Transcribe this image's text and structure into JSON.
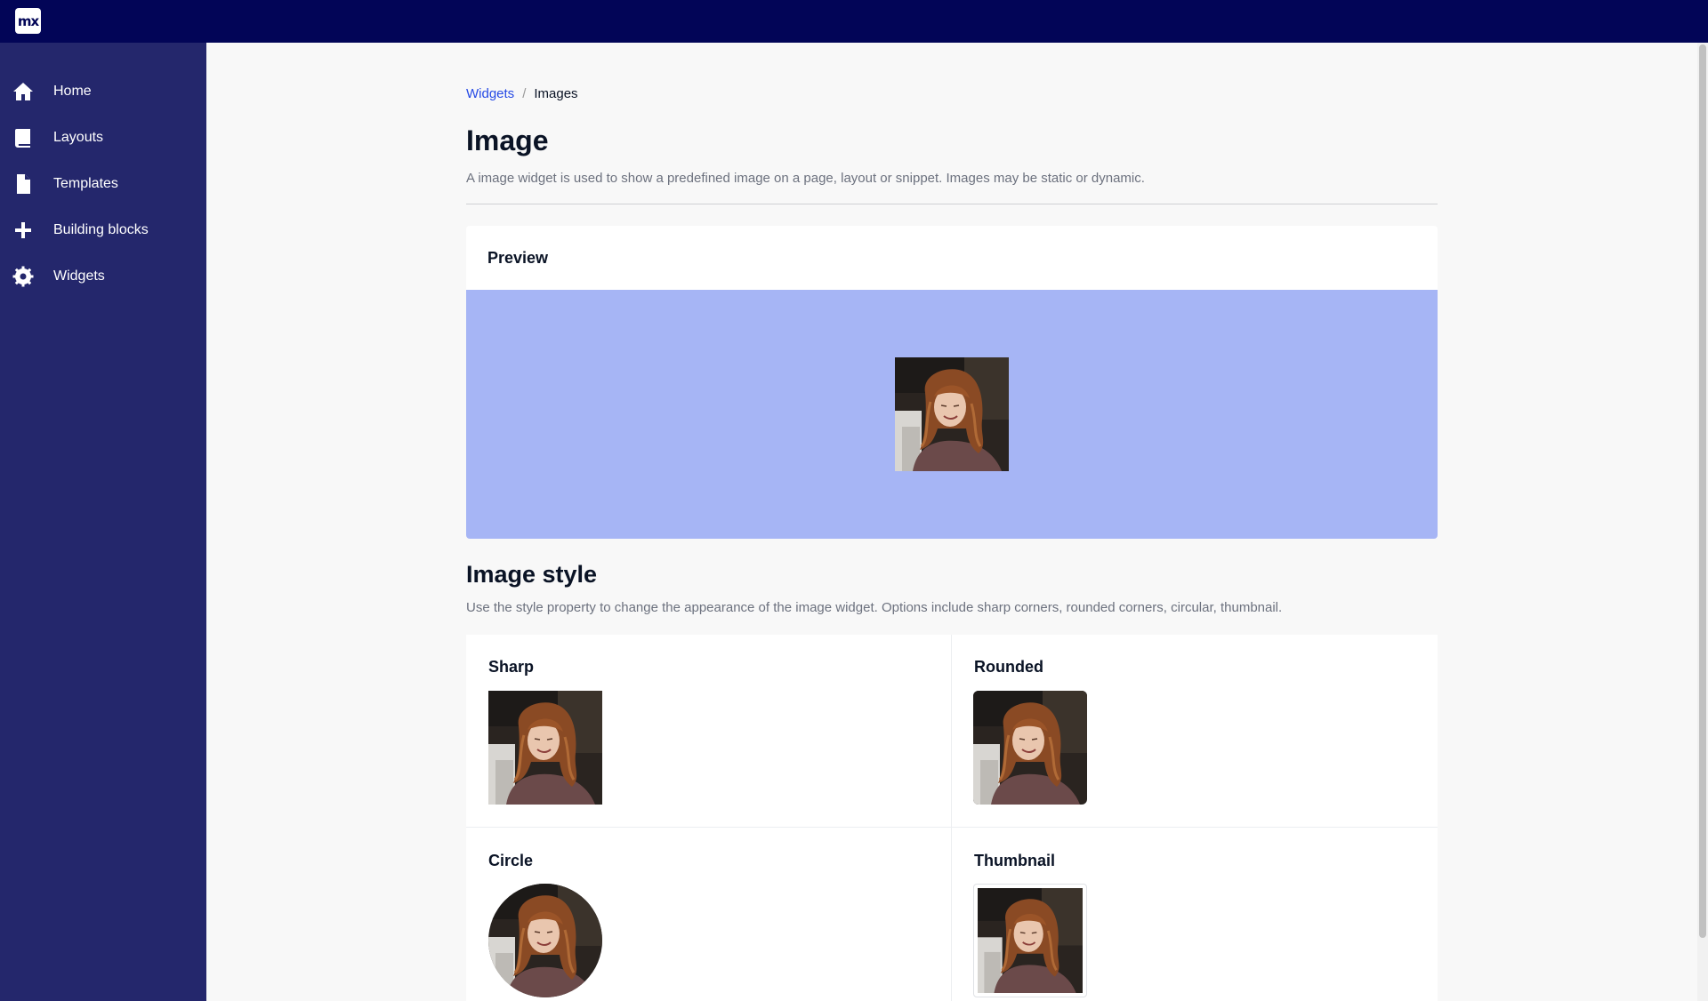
{
  "app": {
    "logo_text": "mx"
  },
  "sidebar": {
    "items": [
      {
        "label": "Home",
        "icon": "home-icon"
      },
      {
        "label": "Layouts",
        "icon": "book-icon"
      },
      {
        "label": "Templates",
        "icon": "file-icon"
      },
      {
        "label": "Building blocks",
        "icon": "plus-icon"
      },
      {
        "label": "Widgets",
        "icon": "gear-icon"
      }
    ]
  },
  "breadcrumb": {
    "parent": "Widgets",
    "separator": "/",
    "current": "Images"
  },
  "page": {
    "title": "Image",
    "description": "A image widget is used to show a predefined image on a page, layout or snippet. Images may be static or dynamic."
  },
  "preview": {
    "title": "Preview"
  },
  "style_section": {
    "title": "Image style",
    "description": "Use the style property to change the appearance of the image widget. Options include sharp corners, rounded corners, circular, thumbnail.",
    "options": [
      {
        "label": "Sharp"
      },
      {
        "label": "Rounded"
      },
      {
        "label": "Circle"
      },
      {
        "label": "Thumbnail"
      }
    ]
  },
  "colors": {
    "topbar": "#020557",
    "sidebar": "#24276c",
    "link": "#264ae5",
    "preview_background": "#a6b5f5"
  }
}
